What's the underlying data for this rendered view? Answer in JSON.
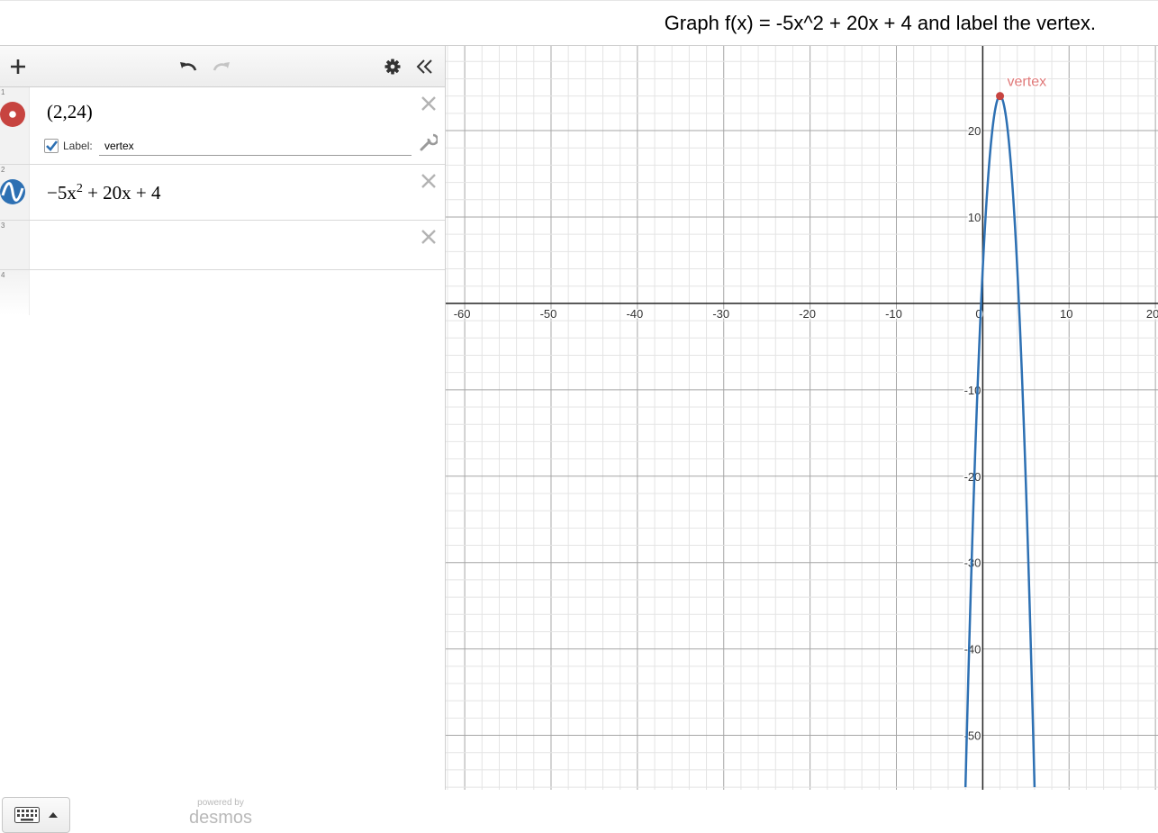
{
  "header": {
    "prompt": "Graph f(x) = -5x^2 + 20x + 4 and label the vertex."
  },
  "expressions": [
    {
      "number": "1",
      "latex": "(2,24)",
      "color": "#c74440",
      "label_checkbox": "Label:",
      "label_value": "vertex"
    },
    {
      "number": "2",
      "latex": "−5x² + 20x + 4",
      "color": "#2d70b3"
    },
    {
      "number": "3",
      "latex": ""
    },
    {
      "number": "4",
      "latex": ""
    }
  ],
  "toolbar": {
    "icons": [
      "plus-icon",
      "undo-icon",
      "redo-icon",
      "gear-icon",
      "double-chevron-left-icon"
    ]
  },
  "footer": {
    "powered_by": "powered by",
    "brand": "desmos"
  },
  "chart_data": {
    "type": "line",
    "function": "-5x^2 + 20x + 4",
    "point": {
      "x": 2,
      "y": 24,
      "label": "vertex"
    },
    "xlim": [
      -62.2,
      20.3
    ],
    "ylim": [
      -56.3,
      29.8
    ],
    "x_ticks": [
      -60,
      -50,
      -40,
      -30,
      -20,
      -10,
      0,
      10,
      20
    ],
    "y_ticks": [
      -50,
      -40,
      -30,
      -20,
      -10,
      10,
      20
    ],
    "x_tick_labels": [
      "-60",
      "-50",
      "-40",
      "-30",
      "-20",
      "-10",
      "0",
      "10",
      "20"
    ],
    "y_tick_labels": [
      "-50",
      "-40",
      "-30",
      "-20",
      "-10",
      "10",
      "20"
    ],
    "grid": true,
    "minor_grid_step": 2,
    "curve_color": "#2d70b3",
    "point_color": "#c74440",
    "label_color": "#e07a7a"
  }
}
